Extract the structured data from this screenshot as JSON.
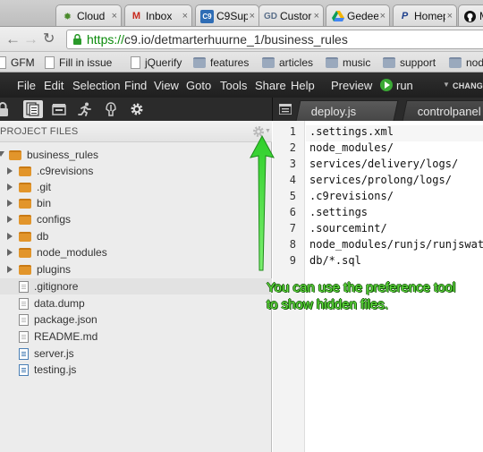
{
  "browser": {
    "tabs": [
      {
        "label": "Cloud",
        "icon": "gear-icon",
        "color": "#4a8a2c"
      },
      {
        "label": "Inbox",
        "icon": "gmail-icon",
        "color": "#c8291c"
      },
      {
        "label": "C9Sup",
        "icon": "c9-icon",
        "color": "#2f6db5"
      },
      {
        "label": "Custor",
        "icon": "gd-icon",
        "color": "#5a6f8a"
      },
      {
        "label": "Gedee",
        "icon": "google-drive-icon",
        "color": "#f4b400"
      },
      {
        "label": "Homep",
        "icon": "paypal-icon",
        "color": "#1d3f8c"
      },
      {
        "label": "My",
        "icon": "github-icon",
        "color": "#111111"
      }
    ],
    "url_scheme": "https://",
    "url_rest": "c9.io/detmarterhuurne_1/business_rules",
    "bookmarks": [
      "GFM",
      "Fill in issue",
      "jQuerify",
      "features",
      "articles",
      "music",
      "support",
      "nod"
    ]
  },
  "ide": {
    "menu": [
      "File",
      "Edit",
      "Selection",
      "Find",
      "View",
      "Goto",
      "Tools",
      "Share",
      "Help"
    ],
    "preview_label": "Preview",
    "run_label": "run",
    "changes_label": "CHANGE",
    "editor_tabs": [
      "deploy.js",
      "controlpanel"
    ],
    "project_files_title": "PROJECT FILES",
    "tree": [
      {
        "name": "business_rules",
        "type": "folder",
        "open": true,
        "depth": 0
      },
      {
        "name": ".c9revisions",
        "type": "folder",
        "depth": 1
      },
      {
        "name": ".git",
        "type": "folder",
        "depth": 1
      },
      {
        "name": "bin",
        "type": "folder",
        "depth": 1
      },
      {
        "name": "configs",
        "type": "folder",
        "depth": 1
      },
      {
        "name": "db",
        "type": "folder",
        "depth": 1
      },
      {
        "name": "node_modules",
        "type": "folder",
        "depth": 1
      },
      {
        "name": "plugins",
        "type": "folder",
        "depth": 1
      },
      {
        "name": ".gitignore",
        "type": "file",
        "depth": 1,
        "highlight": true
      },
      {
        "name": "data.dump",
        "type": "file",
        "depth": 1
      },
      {
        "name": "package.json",
        "type": "file",
        "depth": 1
      },
      {
        "name": "README.md",
        "type": "file",
        "depth": 1
      },
      {
        "name": "server.js",
        "type": "js",
        "depth": 1
      },
      {
        "name": "testing.js",
        "type": "js",
        "depth": 1
      }
    ],
    "code_lines": [
      ".settings.xml",
      "node_modules/",
      "services/delivery/logs/",
      "services/prolong/logs/",
      ".c9revisions/",
      ".settings",
      ".sourcemint/",
      "node_modules/runjs/runjswatch",
      "db/*.sql"
    ],
    "line_numbers": [
      "1",
      "2",
      "3",
      "4",
      "5",
      "6",
      "7",
      "8",
      "9"
    ]
  },
  "annotation": {
    "line1": "You can use the preference tool",
    "line2": "to show hidden files.",
    "color": "#5fe23b"
  }
}
